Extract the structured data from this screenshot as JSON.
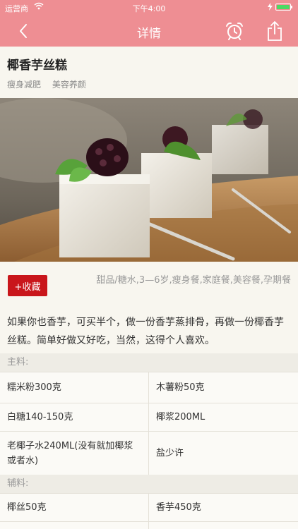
{
  "status_bar": {
    "carrier": "运营商",
    "time": "下午4:00",
    "battery_level": 1.0
  },
  "nav": {
    "title": "详情",
    "icons": [
      "back-chevron-icon",
      "alarm-clock-icon",
      "share-icon"
    ]
  },
  "recipe": {
    "title": "椰香芋丝糕",
    "tags": [
      "瘦身减肥",
      "美容养颜"
    ],
    "favorite_label": "+收藏",
    "categories": "甜品/糖水,3—6岁,瘦身餐,家庭餐,美容餐,孕期餐",
    "intro": "如果你也香芋，可买半个，做一份香芋蒸排骨，再做一份椰香芋丝糕。简单好做又好吃，当然，这得个人喜欢。"
  },
  "ingredients": {
    "main_label": "主料:",
    "main": [
      [
        "糯米粉300克",
        "木薯粉50克"
      ],
      [
        "白糖140-150克",
        "椰浆200ML"
      ],
      [
        "老椰子水240ML(没有就加椰浆或者水)",
        "盐少许"
      ]
    ],
    "aux_label": "辅料:",
    "aux": [
      [
        "椰丝50克",
        "香芋450克"
      ]
    ]
  },
  "colors": {
    "nav_bg": "#ee8e93",
    "favorite_bg": "#c9161b",
    "page_bg": "#f8f6ef"
  }
}
